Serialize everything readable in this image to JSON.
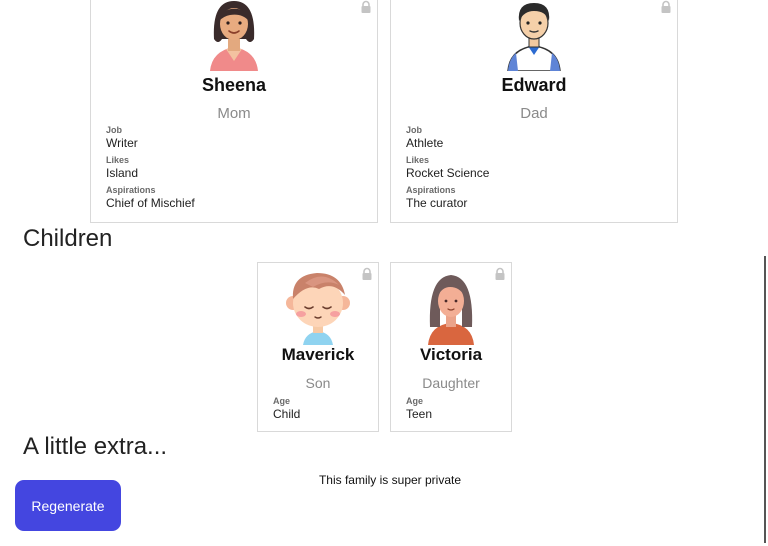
{
  "parents": [
    {
      "id": "mom",
      "name": "Sheena",
      "role": "Mom",
      "attributes": [
        {
          "label": "Job",
          "value": "Writer"
        },
        {
          "label": "Likes",
          "value": "Island"
        },
        {
          "label": "Aspirations",
          "value": "Chief of Mischief"
        }
      ],
      "avatar_icon": "woman-avatar-icon"
    },
    {
      "id": "dad",
      "name": "Edward",
      "role": "Dad",
      "attributes": [
        {
          "label": "Job",
          "value": "Athlete"
        },
        {
          "label": "Likes",
          "value": "Rocket Science"
        },
        {
          "label": "Aspirations",
          "value": "The curator"
        }
      ],
      "avatar_icon": "man-avatar-icon"
    }
  ],
  "children_heading": "Children",
  "children": [
    {
      "id": "son",
      "name": "Maverick",
      "role": "Son",
      "attributes": [
        {
          "label": "Age",
          "value": "Child"
        }
      ],
      "avatar_icon": "boy-avatar-icon"
    },
    {
      "id": "daughter",
      "name": "Victoria",
      "role": "Daughter",
      "attributes": [
        {
          "label": "Age",
          "value": "Teen"
        }
      ],
      "avatar_icon": "girl-avatar-icon"
    }
  ],
  "extra_heading": "A little extra...",
  "extra_text": "This family is super private",
  "regenerate_label": "Regenerate",
  "colors": {
    "accent": "#4446e0",
    "muted_text": "#8a8a8a",
    "card_border": "#d9d9d9",
    "lock_icon": "#c4c4c4"
  }
}
